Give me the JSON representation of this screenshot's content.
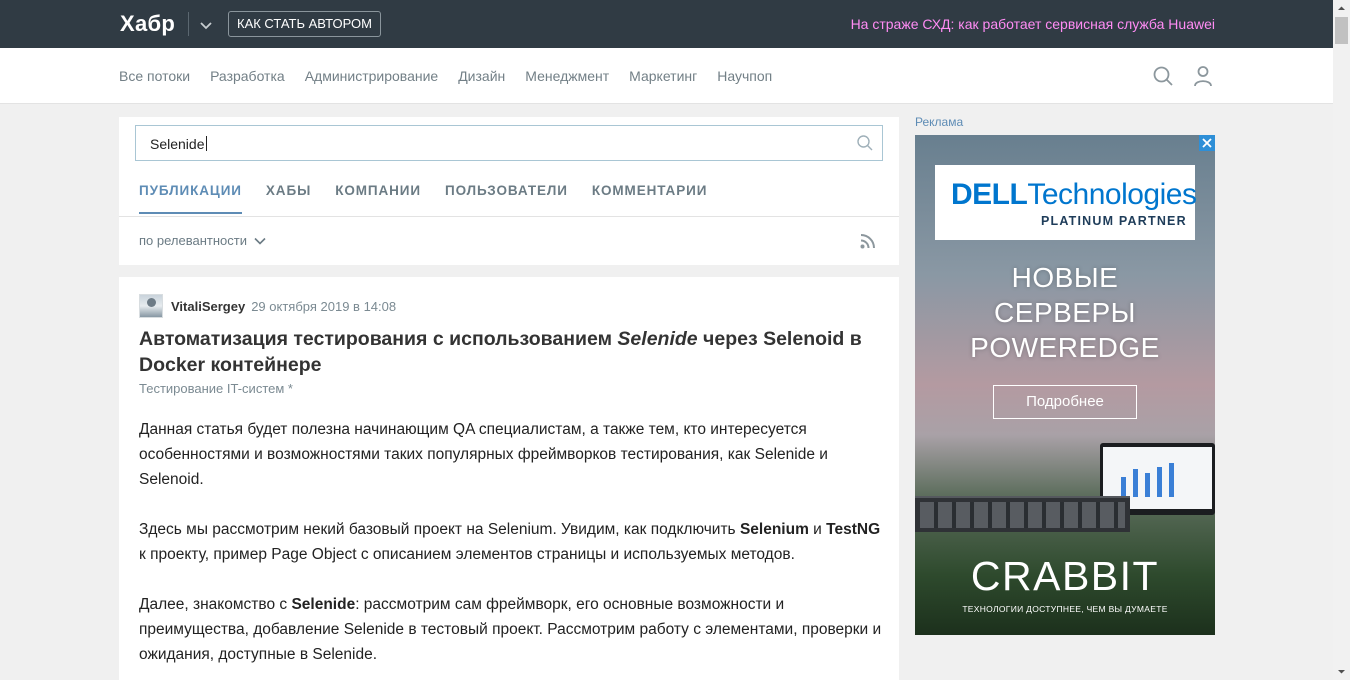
{
  "header": {
    "logo": "Хабр",
    "author_button": "КАК СТАТЬ АВТОРОМ",
    "promo_link": "На страже СХД: как работает сервисная служба Huawei"
  },
  "nav": {
    "links": [
      "Все потоки",
      "Разработка",
      "Администрирование",
      "Дизайн",
      "Менеджмент",
      "Маркетинг",
      "Научпоп"
    ]
  },
  "search": {
    "value": "Selenide",
    "tabs": [
      "ПУБЛИКАЦИИ",
      "ХАБЫ",
      "КОМПАНИИ",
      "ПОЛЬЗОВАТЕЛИ",
      "КОММЕНТАРИИ"
    ],
    "active_tab": "ПУБЛИКАЦИИ",
    "sort_label": "по релевантности"
  },
  "article": {
    "author": "VitaliSergey",
    "date": "29 октября 2019 в 14:08",
    "title_before": "Автоматизация тестирования с использованием ",
    "title_em": "Selenide",
    "title_after": " через Selenoid в Docker контейнере",
    "hub": "Тестирование IT-систем *",
    "p1": "Данная статья будет полезна начинающим QA специалистам, а также тем, кто интересуется особенностями и возможностями таких популярных фреймворков тестирования, как Selenide и Selenoid.",
    "p2_a": "Здесь мы рассмотрим некий базовый проект на Selenium. Увидим, как подключить ",
    "p2_b": "Selenium",
    "p2_c": " и ",
    "p2_d": "TestNG",
    "p2_e": " к проекту, пример Page Object с описанием элементов страницы и используемых методов.",
    "p3_a": "Далее, знакомство с ",
    "p3_b": "Selenide",
    "p3_c": ": рассмотрим сам фреймворк, его основные возможности и преимущества, добавление Selenide в тестовый проект. Рассмотрим работу с элементами, проверки и ожидания, доступные в Selenide."
  },
  "ad": {
    "label": "Реклама",
    "dell_brand": "DELL",
    "dell_word": "Technologies",
    "dell_partner": "PLATINUM PARTNER",
    "headline_1": "НОВЫЕ",
    "headline_2": "СЕРВЕРЫ",
    "headline_3": "POWEREDGE",
    "button": "Подробнее",
    "brand": "CRABBIT",
    "tagline": "ТЕХНОЛОГИИ ДОСТУПНЕЕ, ЧЕМ ВЫ ДУМАЕТЕ"
  },
  "colors": {
    "topbar": "#303b44",
    "promo": "#ff8cf4",
    "accent": "#5e8cb5",
    "dell_blue": "#0076ce"
  }
}
